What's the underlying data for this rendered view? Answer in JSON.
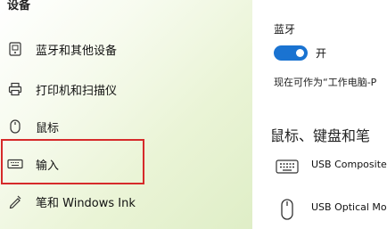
{
  "sidebar": {
    "section_title": "设备",
    "items": [
      {
        "label": "蓝牙和其他设备",
        "icon": "bluetooth-devices-icon"
      },
      {
        "label": "打印机和扫描仪",
        "icon": "printer-icon"
      },
      {
        "label": "鼠标",
        "icon": "mouse-icon"
      },
      {
        "label": "输入",
        "icon": "keyboard-icon",
        "highlighted": true
      },
      {
        "label": "笔和 Windows Ink",
        "icon": "pen-icon"
      }
    ]
  },
  "main": {
    "bluetooth_label": "蓝牙",
    "bluetooth_toggle_state": "开",
    "bluetooth_toggle_on": true,
    "discoverable_text": "现在可作为“工作电脑-P",
    "devices_title": "鼠标、键盘和笔",
    "devices": [
      {
        "name": "USB Composite",
        "icon": "keyboard-icon"
      },
      {
        "name": "USB Optical Mo",
        "icon": "mouse-icon"
      }
    ]
  },
  "colors": {
    "accent": "#1a73d1",
    "highlight_border": "#d62a2a"
  }
}
